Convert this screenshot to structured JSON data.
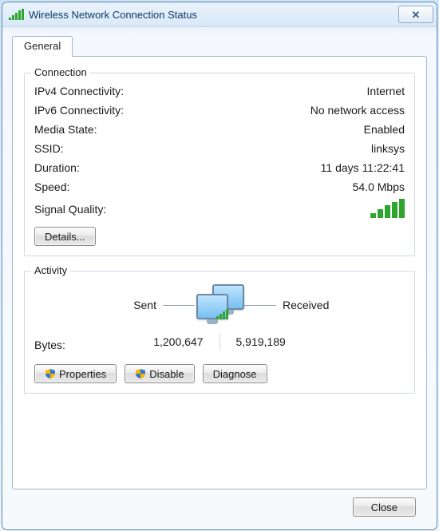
{
  "window": {
    "title": "Wireless Network Connection Status"
  },
  "tabs": {
    "general": "General"
  },
  "connection": {
    "legend": "Connection",
    "ipv4_label": "IPv4 Connectivity:",
    "ipv4_value": "Internet",
    "ipv6_label": "IPv6 Connectivity:",
    "ipv6_value": "No network access",
    "media_label": "Media State:",
    "media_value": "Enabled",
    "ssid_label": "SSID:",
    "ssid_value": "linksys",
    "duration_label": "Duration:",
    "duration_value": "11 days 11:22:41",
    "speed_label": "Speed:",
    "speed_value": "54.0 Mbps",
    "signal_label": "Signal Quality:",
    "details_button": "Details..."
  },
  "activity": {
    "legend": "Activity",
    "sent_label": "Sent",
    "received_label": "Received",
    "bytes_label": "Bytes:",
    "bytes_sent": "1,200,647",
    "bytes_received": "5,919,189",
    "properties_button": "Properties",
    "disable_button": "Disable",
    "diagnose_button": "Diagnose"
  },
  "footer": {
    "close_button": "Close"
  }
}
